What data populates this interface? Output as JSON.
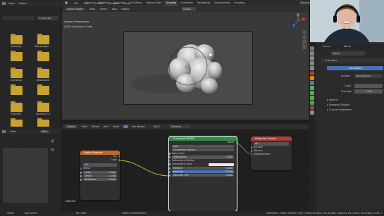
{
  "colors": {
    "accent": "#4772b3",
    "node_header_texture": "#c06a2b",
    "node_header_shader": "#2e8b4a",
    "node_header_output": "#b53a3a",
    "selected_node_outline": "#ffffff",
    "folder": "#c9a234"
  },
  "file_browser": {
    "menu": [
      "View",
      "Select"
    ],
    "path": "C:\\Users\\b",
    "folders": [
      "Audacity",
      "Blackmagic…",
      "",
      "",
      "Camtasia",
      "Downloads",
      "",
      "",
      "FAVORIE",
      "Houdini17.5",
      "",
      ""
    ]
  },
  "topbar": {
    "menu": [
      "File",
      "Edit",
      "Render",
      "Window",
      "Help"
    ],
    "workspaces": [
      "Layout",
      "Modeling",
      "Sculpting",
      "UV Editing",
      "Texture Paint",
      "Shading",
      "Animation",
      "Rendering",
      "Compositing",
      "Scripting"
    ],
    "active_workspace": "Shading",
    "right_label": "ViewLayer"
  },
  "viewport": {
    "mode": "Object Mode",
    "menu": [
      "View",
      "Select",
      "Add",
      "Object"
    ],
    "camera_label": "Camera Perspective",
    "collection_label": "(287) Collection | Cube",
    "shading": "Global"
  },
  "node_editor": {
    "header": {
      "editor": "Object",
      "menu": [
        "View",
        "Select",
        "Add",
        "Node"
      ],
      "use_nodes": "Use Nodes",
      "slot": "Slot 1",
      "material": "Material"
    },
    "material_label": "Material",
    "noise": {
      "title": "Noise Texture",
      "outputs": [
        "Fac",
        "Color"
      ],
      "dim": "3D",
      "inputs": [
        "Vector"
      ],
      "fields": [
        {
          "label": "Scale",
          "value": "5.000"
        },
        {
          "label": "Detail",
          "value": "2.000"
        },
        {
          "label": "Distortion",
          "value": "0.000"
        }
      ]
    },
    "bsdf": {
      "title": "Principled BSDF",
      "output": "BSDF",
      "dist": "GGX",
      "sss": "Christensen-Burley",
      "rows": [
        {
          "label": "Base Color",
          "value": ""
        },
        {
          "label": "Subsurface",
          "value": "0.000"
        },
        {
          "label": "Subsurface Radius",
          "value": ""
        },
        {
          "label": "Subsurface Color",
          "value": ""
        },
        {
          "label": "Metallic",
          "value": "0.000"
        },
        {
          "label": "Specular",
          "value": "0.500"
        },
        {
          "label": "Specular Tint",
          "value": "0.000"
        }
      ]
    },
    "output": {
      "title": "Material Output",
      "target": "All",
      "sockets": [
        "Surface",
        "Volume",
        "Displacement"
      ]
    }
  },
  "image_editor": {
    "menu": [
      "View"
    ],
    "new_label": "New"
  },
  "properties": {
    "tabs": [
      "Scene",
      "World"
    ],
    "world_name": "World",
    "surface_panel": "Surface",
    "use_nodes": "Use Nodes",
    "surface_label": "Surface",
    "surface_value": "Background",
    "color_label": "Color",
    "strength_label": "Strength",
    "strength_value": "1.000",
    "panels": [
      "Volume",
      "Viewport Display",
      "Custom Properties"
    ]
  },
  "statusbar": {
    "left": [
      "Select",
      "Box Select"
    ],
    "mid": [
      "Pan View",
      "Object Context Menu"
    ],
    "right": "Collection | Cube | Verts:17,922 | Faces:22,004 | Tris:42,008 | Objects:1/4 | Mem: 20.4 MiB | v2.81.7"
  }
}
